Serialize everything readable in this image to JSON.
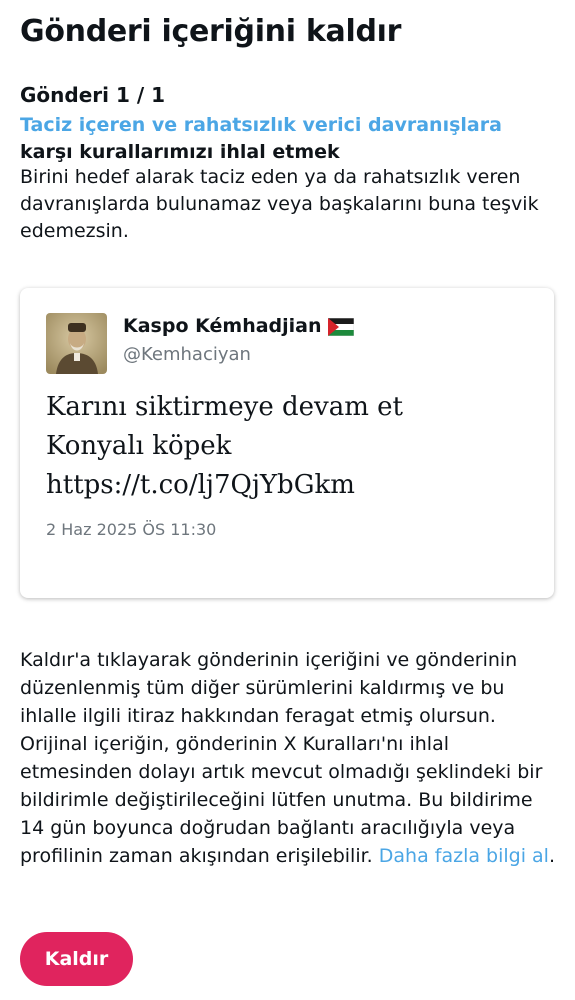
{
  "header": {
    "title": "Gönderi içeriğini kaldır"
  },
  "post_counter": "Gönderi 1 / 1",
  "rule": {
    "link_text": "Taciz içeren ve rahatsızlık verici davranışlara",
    "heading_rest": " karşı kurallarımızı ihlal etmek",
    "description": "Birini hedef alarak taciz eden ya da rahatsızlık veren davranışlarda bulunamaz veya başkalarını buna teşvik edemezsin."
  },
  "tweet": {
    "author_name": "Kaspo Kémhadjian",
    "author_flag": "palestine-flag-icon",
    "author_handle": "@Kemhaciyan",
    "text_lines": [
      "Karını siktirmeye devam et",
      "Konyalı köpek",
      "https://t.co/lj7QjYbGkm"
    ],
    "date": "2 Haz 2025 ÖS 11:30"
  },
  "notice": {
    "text": "Kaldır'a tıklayarak gönderinin içeriğini ve gönderinin düzenlenmiş tüm diğer sürümlerini kaldırmış ve bu ihlalle ilgili itiraz hakkından feragat etmiş olursun. Orijinal içeriğin, gönderinin X Kuralları'nı ihlal etmesinden dolayı artık mevcut olmadığı şeklindeki bir bildirimle değiştirileceğini lütfen unutma. Bu bildirime 14 gün boyunca doğrudan bağlantı aracılığıyla veya profilinin zaman akışından erişilebilir.",
    "link_text": "Daha fazla bilgi al",
    "link_suffix": "."
  },
  "actions": {
    "remove_label": "Kaldır"
  },
  "colors": {
    "link": "#4ba6e5",
    "danger": "#e0245e",
    "muted": "#6e767d",
    "text": "#0f1419"
  }
}
